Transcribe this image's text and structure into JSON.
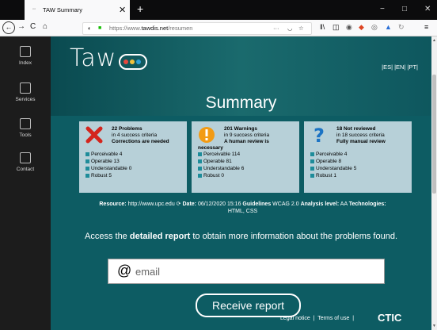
{
  "browser": {
    "tab_title": "TAW Summary",
    "tab_close": "✕",
    "new_tab": "+",
    "url_prefix": "https://www.",
    "url_domain": "tawdis.net",
    "url_path": "/resumen",
    "url_more": "···",
    "minimize": "−",
    "maximize": "□",
    "close": "✕"
  },
  "sidebar": {
    "items": [
      {
        "label": "Index"
      },
      {
        "label": "Services"
      },
      {
        "label": "Tools"
      },
      {
        "label": "Contact"
      }
    ]
  },
  "header": {
    "logo": "Taw",
    "languages": "|ES| |EN| |PT|",
    "title": "Summary",
    "logo_dots": [
      "#e8483e",
      "#f2c23d",
      "#2f9fd6"
    ]
  },
  "cards": [
    {
      "type": "problems",
      "count_line": "22 Problems",
      "criteria": "in 4 success criteria",
      "note": "Corrections are needed",
      "items": [
        "Perceivable 4",
        "Operable 13",
        "Understandable 0",
        "Robust 5"
      ],
      "icon_color": "#d4251d"
    },
    {
      "type": "warnings",
      "count_line": "201 Warnings",
      "criteria": "in 9 success criteria",
      "note": "A human review is",
      "note2": "necessary",
      "items": [
        "Perceivable 114",
        "Operable 81",
        "Understandable 6",
        "Robust 0"
      ],
      "icon_color": "#f29b14"
    },
    {
      "type": "not_reviewed",
      "count_line": "18 Not reviewed",
      "criteria": "in 18 success criteria",
      "note": "Fully manual review",
      "items": [
        "Perceivable 4",
        "Operable 8",
        "Understandable 5",
        "Robust 1"
      ],
      "icon_color": "#1b73c4"
    }
  ],
  "resource": {
    "resource_label": "Resource:",
    "resource_value": "http://www.upc.edu",
    "date_label": "Date:",
    "date_value": "06/12/2020 15:16",
    "guidelines_label": "Guidelines",
    "guidelines_value": "WCAG 2.0",
    "analysis_label": "Analysis level:",
    "analysis_value": "AA",
    "tech_label": "Technologies:",
    "tech_value": "HTML, CSS"
  },
  "access": {
    "prefix": "Access the",
    "bold": "detailed report",
    "suffix": "to obtain more information about the problems found."
  },
  "form": {
    "at_symbol": "@",
    "email_placeholder": "email",
    "submit_label": "Receive report"
  },
  "footer": {
    "legal": "Legal notice",
    "terms": "Terms of use",
    "brand": "CTIC"
  },
  "colors": {
    "accent": "#0d5c63",
    "card_bg": "#b7d0d8"
  }
}
